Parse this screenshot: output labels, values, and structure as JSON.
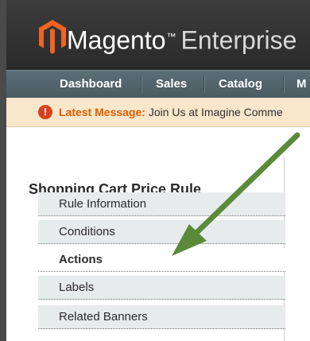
{
  "header": {
    "brand": "Magento",
    "trademark": "™",
    "edition": "Enterprise",
    "logo_icon": "magento-logo-icon",
    "brand_color": "#f26322"
  },
  "nav": {
    "items": [
      {
        "label": "Dashboard"
      },
      {
        "label": "Sales"
      },
      {
        "label": "Catalog"
      },
      {
        "label": "M"
      }
    ]
  },
  "message": {
    "icon": "alert-icon",
    "label": "Latest Message:",
    "text": "Join Us at Imagine Comme"
  },
  "panel": {
    "title": "Shopping Cart Price Rule",
    "tabs": [
      {
        "label": "Rule Information",
        "active": false
      },
      {
        "label": "Conditions",
        "active": false
      },
      {
        "label": "Actions",
        "active": true
      },
      {
        "label": "Labels",
        "active": false
      },
      {
        "label": "Related Banners",
        "active": false
      }
    ]
  },
  "annotation": {
    "arrow_color": "#5a8a3a"
  }
}
